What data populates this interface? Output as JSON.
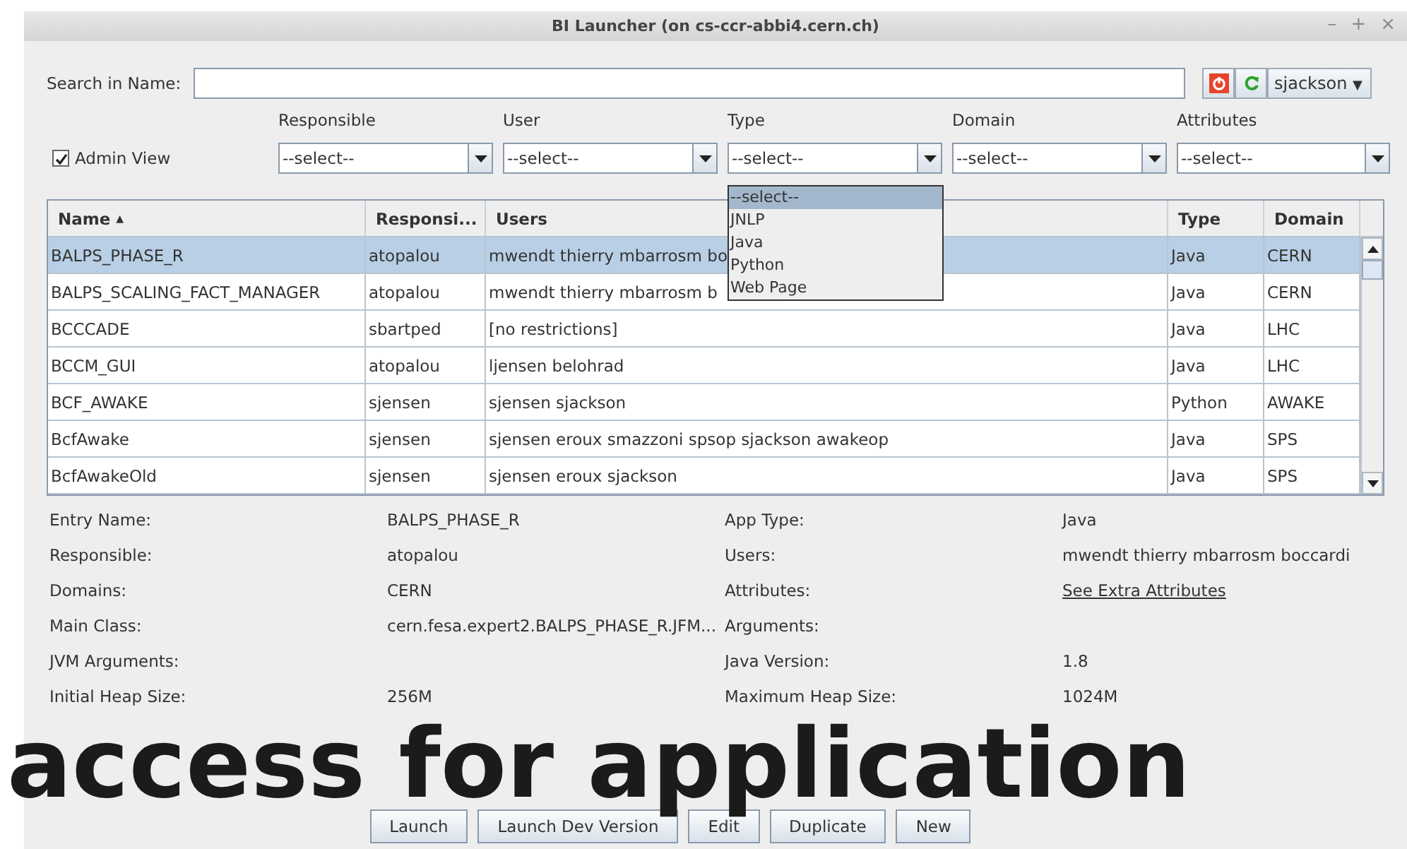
{
  "window": {
    "title": "BI Launcher (on cs-ccr-abbi4.cern.ch)",
    "controls": [
      "–",
      "+",
      "×"
    ]
  },
  "search": {
    "label": "Search in Name:"
  },
  "user_menu": {
    "value": "sjackson",
    "caret": "▼"
  },
  "admin_view": {
    "label": "Admin View",
    "checked": true
  },
  "filters": [
    {
      "label": "Responsible",
      "value": "--select--"
    },
    {
      "label": "User",
      "value": "--select--"
    },
    {
      "label": "Type",
      "value": "--select--",
      "options": [
        {
          "label": "--select--",
          "selected": true
        },
        {
          "label": "JNLP",
          "selected": false
        },
        {
          "label": "Java",
          "selected": false
        },
        {
          "label": "Python",
          "selected": false
        },
        {
          "label": "Web Page",
          "selected": false
        }
      ]
    },
    {
      "label": "Domain",
      "value": "--select--"
    },
    {
      "label": "Attributes",
      "value": "--select--"
    }
  ],
  "table": {
    "columns": [
      {
        "label": "Name",
        "sort_mark": "▲"
      },
      {
        "label": "Responsi..."
      },
      {
        "label": "Users"
      },
      {
        "label": "Type"
      },
      {
        "label": "Domain"
      }
    ],
    "rows": [
      {
        "cells": [
          "BALPS_PHASE_R",
          "atopalou",
          "mwendt thierry mbarrosm bo",
          "Java",
          "CERN"
        ],
        "selected": true
      },
      {
        "cells": [
          "BALPS_SCALING_FACT_MANAGER",
          "atopalou",
          "mwendt thierry mbarrosm b",
          "Java",
          "CERN"
        ],
        "selected": false
      },
      {
        "cells": [
          "BCCCADE",
          "sbartped",
          "[no restrictions]",
          "Java",
          "LHC"
        ],
        "selected": false
      },
      {
        "cells": [
          "BCCM_GUI",
          "atopalou",
          "ljensen belohrad",
          "Java",
          "LHC"
        ],
        "selected": false
      },
      {
        "cells": [
          "BCF_AWAKE",
          "sjensen",
          "sjensen sjackson",
          "Python",
          "AWAKE"
        ],
        "selected": false
      },
      {
        "cells": [
          "BcfAwake",
          "sjensen",
          "sjensen eroux smazzoni spsop sjackson awakeop",
          "Java",
          "SPS"
        ],
        "selected": false
      },
      {
        "cells": [
          "BcfAwakeOld",
          "sjensen",
          "sjensen eroux sjackson",
          "Java",
          "SPS"
        ],
        "selected": false
      }
    ]
  },
  "details": [
    {
      "label": "Entry Name:",
      "value": "BALPS_PHASE_R",
      "kind": "text"
    },
    {
      "label": "App Type:",
      "value": "Java",
      "kind": "text"
    },
    {
      "label": "Responsible:",
      "value": "atopalou",
      "kind": "text"
    },
    {
      "label": "Users:",
      "value": "mwendt thierry mbarrosm boccardi",
      "kind": "text"
    },
    {
      "label": "Domains:",
      "value": "CERN",
      "kind": "text"
    },
    {
      "label": "Attributes:",
      "value": "See Extra Attributes",
      "kind": "link"
    },
    {
      "label": "Main Class:",
      "value": "cern.fesa.expert2.BALPS_PHASE_R.JFM...",
      "kind": "text"
    },
    {
      "label": "Arguments:"
    },
    {
      "label": "JVM Arguments:"
    },
    {
      "label": "Java Version:",
      "value": "1.8",
      "kind": "text"
    },
    {
      "label": "Initial Heap Size:",
      "value": "256M",
      "kind": "text"
    },
    {
      "label": "Maximum Heap Size:",
      "value": "1024M",
      "kind": "text"
    }
  ],
  "buttons": [
    "Launch",
    "Launch Dev Version",
    "Edit",
    "Duplicate",
    "New"
  ],
  "caption": "access for application"
}
